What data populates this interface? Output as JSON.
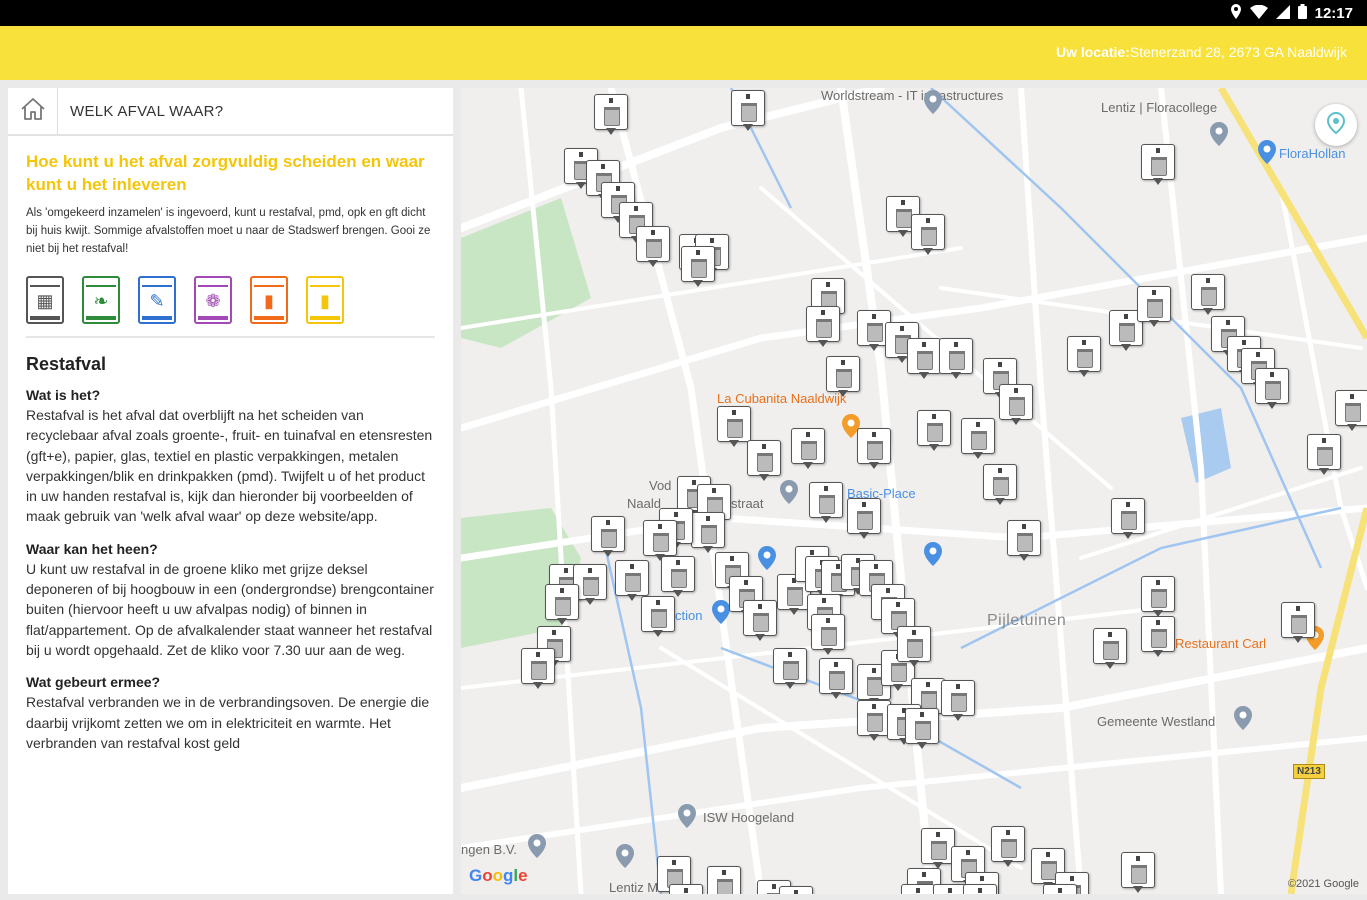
{
  "status_bar": {
    "time": "12:17"
  },
  "app_bar": {
    "location_label": "Uw locatie:",
    "location_value": "Stenerzand 28, 2673 GA Naaldwijk"
  },
  "panel": {
    "title": "WELK AFVAL WAAR?",
    "headline": "Hoe kunt u het afval zorgvuldig scheiden en waar kunt u het inleveren",
    "intro": "Als 'omgekeerd inzamelen' is ingevoerd, kunt u restafval, pmd, opk en gft dicht bij huis kwijt. Sommige afvalstoffen moet u naar de Stadswerf brengen. Gooi ze niet bij het restafval!",
    "bins": [
      {
        "id": "restafval",
        "color": "#555555",
        "icon": "trash-bin-icon"
      },
      {
        "id": "gft",
        "color": "#2e8b3a",
        "icon": "leaf-bin-icon"
      },
      {
        "id": "papier",
        "color": "#2f6fd1",
        "icon": "paper-bin-icon"
      },
      {
        "id": "textiel",
        "color": "#a349b5",
        "icon": "textile-bin-icon"
      },
      {
        "id": "pmd",
        "color": "#f06a1a",
        "icon": "bottle-bin-icon"
      },
      {
        "id": "glas",
        "color": "#f4c60a",
        "icon": "glass-bin-icon"
      }
    ],
    "section_title": "Restafval",
    "sections": [
      {
        "q": "Wat is het?",
        "a": "Restafval is het afval dat overblijft na het scheiden van recyclebaar afval zoals groente-, fruit- en tuinafval en etensresten (gft+e), papier, glas, textiel en plastic verpakkingen, metalen verpakkingen/blik en drinkpakken (pmd). Twijfelt u of het product in uw handen restafval is, kijk dan hieronder bij voorbeelden of maak gebruik van 'welk afval waar' op deze website/app."
      },
      {
        "q": "Waar kan het heen?",
        "a": "U kunt uw restafval in de groene kliko met grijze deksel deponeren of bij hoogbouw in een (ondergrondse) brengcontainer buiten (hiervoor heeft u uw afvalpas nodig) of binnen in flat/appartement. Op de afvalkalender staat wanneer het restafval bij u wordt opgehaald. Zet de kliko voor 7.30 uur aan de weg."
      },
      {
        "q": "Wat gebeurt ermee?",
        "a": "Restafval verbranden we in de verbrandingsoven. De energie die daarbij vrijkomt zetten we om in elektriciteit en warmte. Het verbranden van restafval kost geld"
      }
    ]
  },
  "map": {
    "labels": {
      "worldstream": "Worldstream - IT infrastructures",
      "lentiz": "Lentiz | Floracollege",
      "florahol": "FloraHollan",
      "cubanita": "La Cubanita Naaldwijk",
      "basic": "Basic-Place",
      "pijletuinen": "Pijletuinen",
      "gemeente": "Gemeente Westland",
      "restaurant": "Restaurant Carl",
      "isw": "ISW Hoogeland",
      "lentiz_mavo": "Lentiz MAVO",
      "vod": "Vod",
      "naald": "Naald",
      "straat": "straat",
      "action": "ction",
      "ingen": "ngen B.V.",
      "road": "N213"
    },
    "google": "Google",
    "copyright": "©2021 Google"
  }
}
